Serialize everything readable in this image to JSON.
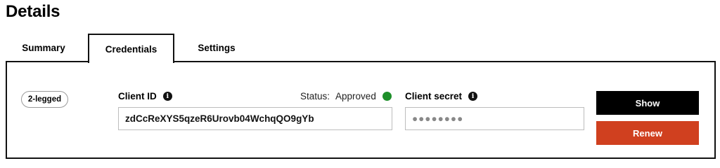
{
  "page": {
    "title": "Details"
  },
  "tabs": [
    {
      "label": "Summary",
      "active": false
    },
    {
      "label": "Credentials",
      "active": true
    },
    {
      "label": "Settings",
      "active": false
    }
  ],
  "credentials": {
    "type_badge": "2-legged",
    "client_id": {
      "label": "Client ID",
      "info_icon": "info-icon",
      "value": "zdCcReXYS5qzeR6Urovb04WchqQO9gYb"
    },
    "status": {
      "label": "Status:",
      "value": "Approved",
      "color": "#1e8f2a"
    },
    "client_secret": {
      "label": "Client secret",
      "info_icon": "info-icon",
      "value": "●●●●●●●●"
    },
    "buttons": {
      "show_label": "Show",
      "renew_label": "Renew"
    }
  },
  "colors": {
    "primary_button": "#000000",
    "danger_button": "#d0401f",
    "status_approved": "#1e8f2a"
  }
}
